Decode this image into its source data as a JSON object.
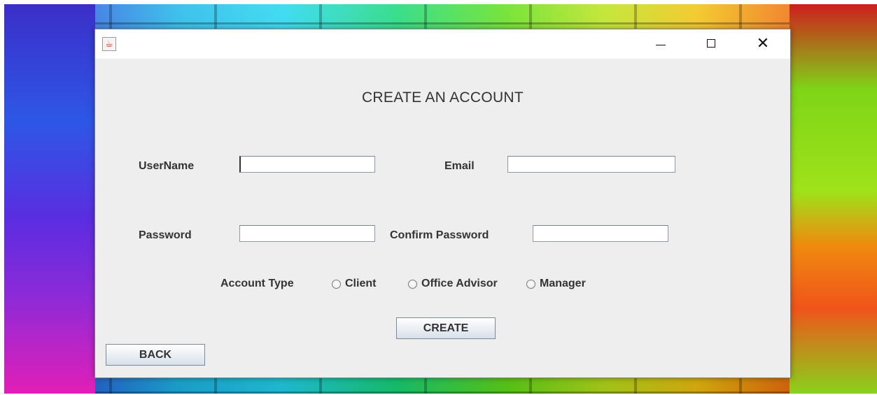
{
  "window": {
    "icon": "java-cup-icon",
    "controls": {
      "minimize": "—",
      "maximize": "☐",
      "close": "✕"
    }
  },
  "form": {
    "title": "CREATE AN ACCOUNT",
    "username_label": "UserName",
    "username_value": "",
    "email_label": "Email",
    "email_value": "",
    "password_label": "Password",
    "password_value": "",
    "confirm_password_label": "Confirm Password",
    "confirm_password_value": "",
    "account_type_label": "Account Type",
    "account_types": [
      "Client",
      "Office Advisor",
      "Manager"
    ],
    "create_label": "CREATE",
    "back_label": "BACK"
  }
}
